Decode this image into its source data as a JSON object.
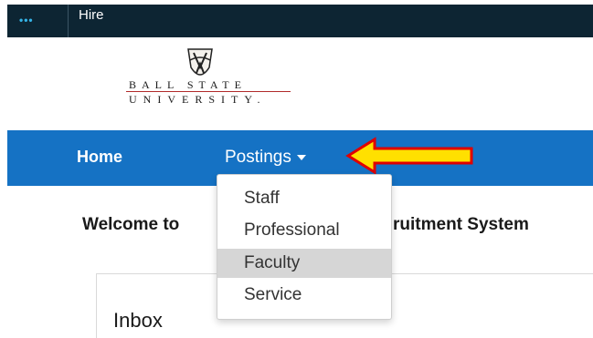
{
  "topbar": {
    "menu_icon": "dots-menu-icon",
    "app_name": "Hire"
  },
  "logo": {
    "line1": "BALL STATE",
    "line2": "UNIVERSITY."
  },
  "nav": {
    "home": "Home",
    "postings": "Postings"
  },
  "welcome": {
    "left": "Welcome to",
    "right": "ruitment System"
  },
  "inbox": {
    "title": "Inbox"
  },
  "dropdown": {
    "items": [
      {
        "label": "Staff"
      },
      {
        "label": "Professional"
      },
      {
        "label": "Faculty",
        "highlighted": true
      },
      {
        "label": "Service"
      }
    ]
  },
  "annotation": {
    "type": "arrow",
    "fill": "#ffe000",
    "stroke": "#e00000"
  },
  "colors": {
    "topbar": "#0d2533",
    "navbar": "#1572c4",
    "highlight": "#d6d6d6"
  }
}
